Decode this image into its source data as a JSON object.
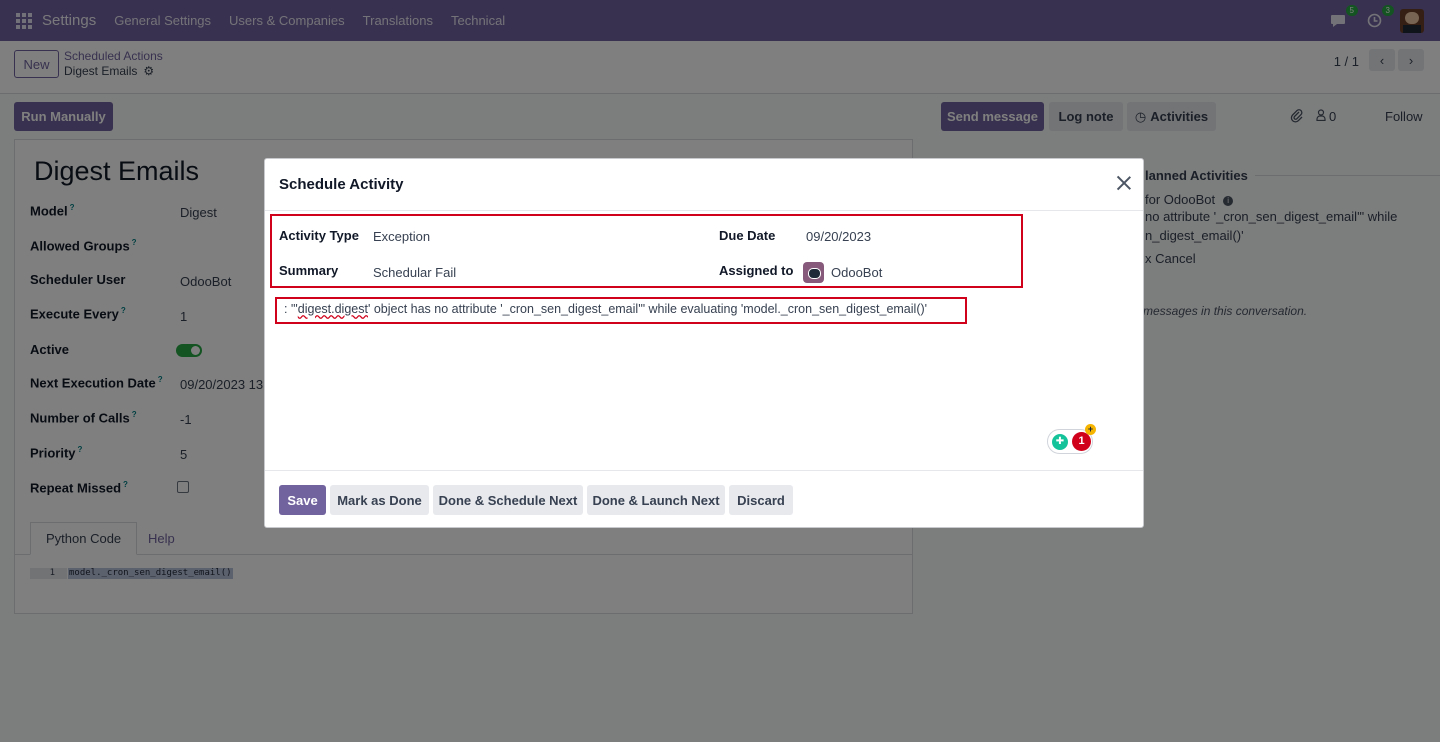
{
  "navbar": {
    "app_name": "Settings",
    "menu": [
      "General Settings",
      "Users & Companies",
      "Translations",
      "Technical"
    ],
    "messages_count": "5",
    "activities_count": "3"
  },
  "control_panel": {
    "new_label": "New",
    "breadcrumb_parent": "Scheduled Actions",
    "breadcrumb_current": "Digest Emails",
    "pager": "1 / 1"
  },
  "form": {
    "run_manually_label": "Run Manually",
    "title": "Digest Emails",
    "fields": {
      "model": {
        "label": "Model",
        "value": "Digest"
      },
      "allowed_groups": {
        "label": "Allowed Groups",
        "value": ""
      },
      "scheduler_user": {
        "label": "Scheduler User",
        "value": "OdooBot"
      },
      "execute_every": {
        "label": "Execute Every",
        "value": "1"
      },
      "active": {
        "label": "Active",
        "value": true
      },
      "next_execution_date": {
        "label": "Next Execution Date",
        "value": "09/20/2023 13"
      },
      "number_of_calls": {
        "label": "Number of Calls",
        "value": "-1"
      },
      "priority": {
        "label": "Priority",
        "value": "5"
      },
      "repeat_missed": {
        "label": "Repeat Missed",
        "value": false
      }
    },
    "tabs": [
      "Python Code",
      "Help"
    ],
    "code": {
      "line_number": "1",
      "text": "model._cron_sen_digest_email()"
    }
  },
  "chatter": {
    "send_message_label": "Send message",
    "log_note_label": "Log note",
    "activities_label": "Activities",
    "followers_count": "0",
    "follow_label": "Follow",
    "planned_activities_title": "lanned Activities",
    "activity_line1": "for OdooBot",
    "activity_line2": "no attribute '_cron_sen_digest_email'\" while",
    "activity_line3": "n_digest_email()'",
    "activity_cancel": "Cancel",
    "no_messages": "messages in this conversation."
  },
  "modal": {
    "title": "Schedule Activity",
    "activity_type_label": "Activity Type",
    "activity_type_value": "Exception",
    "due_date_label": "Due Date",
    "due_date_value": "09/20/2023",
    "summary_label": "Summary",
    "summary_value": "Schedular Fail",
    "assigned_to_label": "Assigned to",
    "assigned_to_value": "OdooBot",
    "note_prefix": ": \"'",
    "note_squiggle": "digest.digest",
    "note_suffix": "' object has no attribute '_cron_sen_digest_email'\" while evaluating 'model._cron_sen_digest_email()'",
    "grammar_count": "1",
    "buttons": {
      "save": "Save",
      "mark_done": "Mark as Done",
      "done_schedule_next": "Done & Schedule Next",
      "done_launch_next": "Done & Launch Next",
      "discard": "Discard"
    }
  },
  "colors": {
    "brand": "#71639e",
    "highlight": "#d0021b",
    "active_toggle": "#28a745"
  }
}
